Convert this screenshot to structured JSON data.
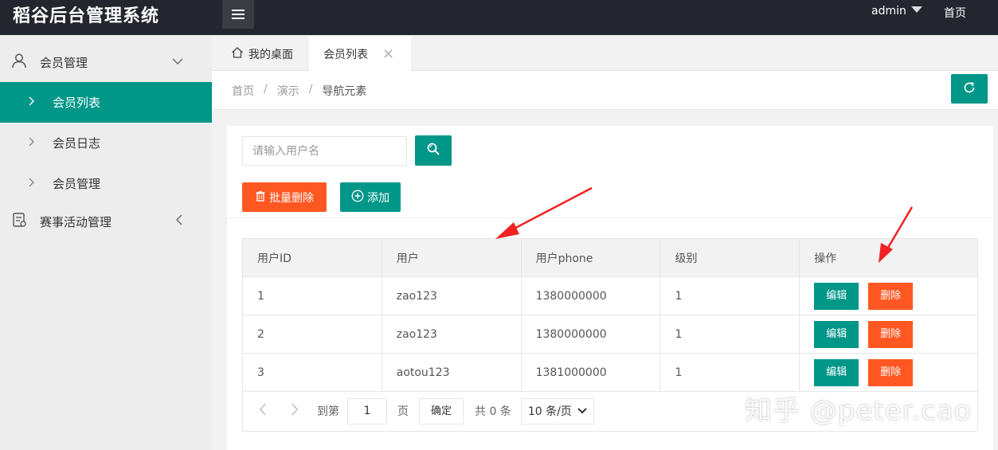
{
  "header": {
    "title": "稻谷后台管理系统",
    "user": "admin",
    "home_link": "首页"
  },
  "sidebar": {
    "groups": [
      {
        "label": "会员管理",
        "items": [
          "会员列表",
          "会员日志",
          "会员管理"
        ]
      },
      {
        "label": "赛事活动管理"
      }
    ],
    "active_item": "会员列表"
  },
  "tabs": [
    {
      "label": "我的桌面",
      "icon": "home-icon"
    },
    {
      "label": "会员列表",
      "closable": true,
      "active": true
    }
  ],
  "breadcrumb": [
    "首页",
    "演示",
    "导航元素"
  ],
  "search": {
    "placeholder": "请输入用户名",
    "value": ""
  },
  "actions": {
    "batch_delete": "批量删除",
    "add": "添加"
  },
  "table": {
    "columns": [
      "用户ID",
      "用户",
      "用户phone",
      "级别",
      "操作"
    ],
    "rows": [
      {
        "id": "1",
        "user": "zao123",
        "phone": "1380000000",
        "level": "1"
      },
      {
        "id": "2",
        "user": "zao123",
        "phone": "1380000000",
        "level": "1"
      },
      {
        "id": "3",
        "user": "aotou123",
        "phone": "1381000000",
        "level": "1"
      }
    ],
    "edit_label": "编辑",
    "delete_label": "删除"
  },
  "pager": {
    "goto": "到第",
    "page_value": "1",
    "page_unit": "页",
    "confirm": "确定",
    "total": "共 0 条",
    "page_size": "10 条/页"
  },
  "watermark": "知乎 @peter.cao",
  "colors": {
    "primary": "#009688",
    "danger": "#ff5722",
    "header": "#23262e",
    "annotation": "#f02222"
  }
}
